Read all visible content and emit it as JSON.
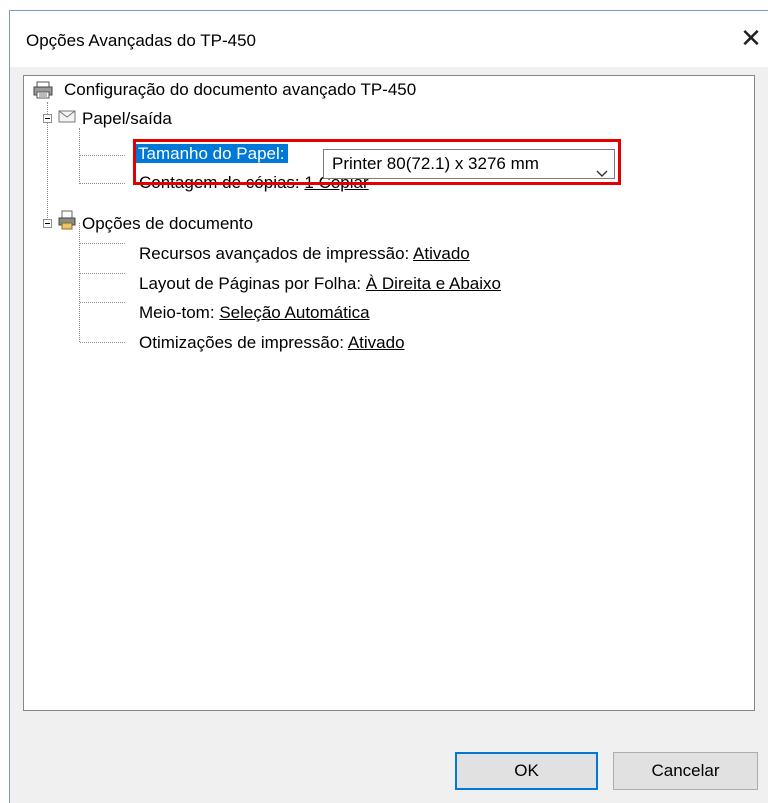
{
  "window": {
    "title": "Opções Avançadas do TP-450"
  },
  "tree": {
    "root": {
      "label": "Configuração do documento avançado TP-450",
      "icon": "printer-icon"
    },
    "paper_output": {
      "label": "Papel/saída",
      "icon": "paper-icon",
      "paper_size": {
        "label": "Tamanho do Papel:",
        "value": "Printer 80(72.1) x 3276 mm"
      },
      "copy_count": {
        "label": "Contagem de cópias:",
        "value": "1 Copiar"
      }
    },
    "document_options": {
      "label": "Opções de documento",
      "icon": "document-options-icon",
      "items": [
        {
          "label": "Recursos avançados de impressão:",
          "value": "Ativado"
        },
        {
          "label": "Layout de Páginas por Folha:",
          "value": "À Direita e Abaixo"
        },
        {
          "label": "Meio-tom:",
          "value": "Seleção Automática"
        },
        {
          "label": "Otimizações de impressão:",
          "value": "Ativado"
        }
      ]
    }
  },
  "buttons": {
    "ok": "OK",
    "cancel": "Cancelar"
  },
  "colors": {
    "selection": "#0078d7",
    "highlight_box": "#e30000"
  }
}
